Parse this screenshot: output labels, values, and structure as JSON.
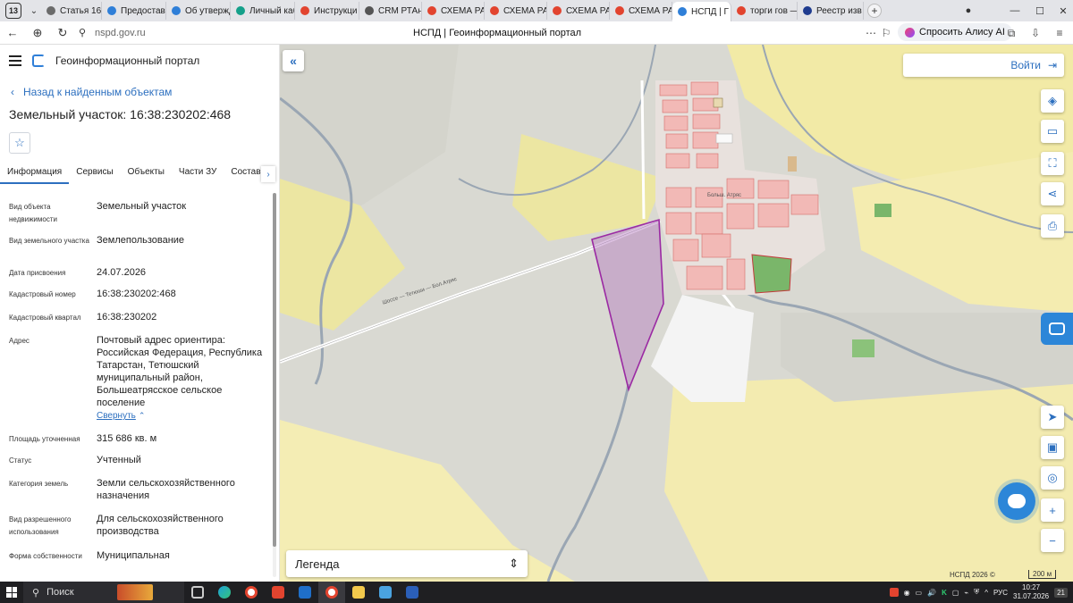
{
  "browser": {
    "tab_count": "13",
    "tabs": [
      {
        "label": "Статья 16 \\",
        "color": "#6b6b6b"
      },
      {
        "label": "Предостав",
        "color": "#2f7fd8"
      },
      {
        "label": "Об утвержд",
        "color": "#2f7fd8"
      },
      {
        "label": "Личный каб",
        "color": "#15a08a"
      },
      {
        "label": "Инструкци",
        "color": "#e2442f"
      },
      {
        "label": "CRM РТАн",
        "color": "#555"
      },
      {
        "label": "СХЕМА РАС",
        "color": "#e2442f"
      },
      {
        "label": "СХЕМА РАС",
        "color": "#e2442f"
      },
      {
        "label": "СХЕМА РАС",
        "color": "#e2442f"
      },
      {
        "label": "СХЕМА РАС",
        "color": "#e2442f"
      },
      {
        "label": "НСПД | Г",
        "color": "#2f7fd8"
      },
      {
        "label": "торги гов —",
        "color": "#e2442f"
      },
      {
        "label": "Реестр изв",
        "color": "#1f3c8f"
      }
    ],
    "active_tab_index": 10,
    "url": "nspd.gov.ru",
    "page_title": "НСПД | Геоинформационный портал",
    "alisa_label": "Спросить Алису AI"
  },
  "sidebar": {
    "portal_name": "Геоинформационный портал",
    "back_label": "Назад к найденным объектам",
    "object_title": "Земельный участок: 16:38:230202:468",
    "tabs": [
      "Информация",
      "Сервисы",
      "Объекты",
      "Части ЗУ",
      "Состав"
    ],
    "properties": [
      {
        "key": "Вид объекта недвижимости",
        "value": "Земельный участок"
      },
      {
        "key": "Вид земельного участка",
        "value": "Землепользование"
      },
      {
        "key": "Дата присвоения",
        "value": "24.07.2026"
      },
      {
        "key": "Кадастровый номер",
        "value": "16:38:230202:468"
      },
      {
        "key": "Кадастровый квартал",
        "value": "16:38:230202"
      },
      {
        "key": "Адрес",
        "value": "Почтовый адрес ориентира: Российская Федерация, Республика Татарстан, Тетюшский муниципальный район, Большеатрясское сельское поселение"
      },
      {
        "key": "Площадь уточненная",
        "value": "315 686 кв. м"
      },
      {
        "key": "Статус",
        "value": "Учтенный"
      },
      {
        "key": "Категория земель",
        "value": "Земли сельскохозяйственного назначения"
      },
      {
        "key": "Вид разрешенного использования",
        "value": "Для сельскохозяйственного производства"
      },
      {
        "key": "Форма собственности",
        "value": "Муниципальная"
      }
    ],
    "collapse_label": "Свернуть"
  },
  "map": {
    "login_label": "Войти",
    "legend_label": "Легенда",
    "copyright": "НСПД 2026 ©",
    "scale_label": "200 м",
    "road_label": "Шоссе — Тетюши — Бол.Атряс",
    "parcel_color": "#9b2aa3",
    "village_label": "Больш. Атряс"
  },
  "taskbar": {
    "search_placeholder": "Поиск",
    "language": "РУС",
    "time": "10:27",
    "date": "31.07.2026",
    "notifications": "21"
  }
}
